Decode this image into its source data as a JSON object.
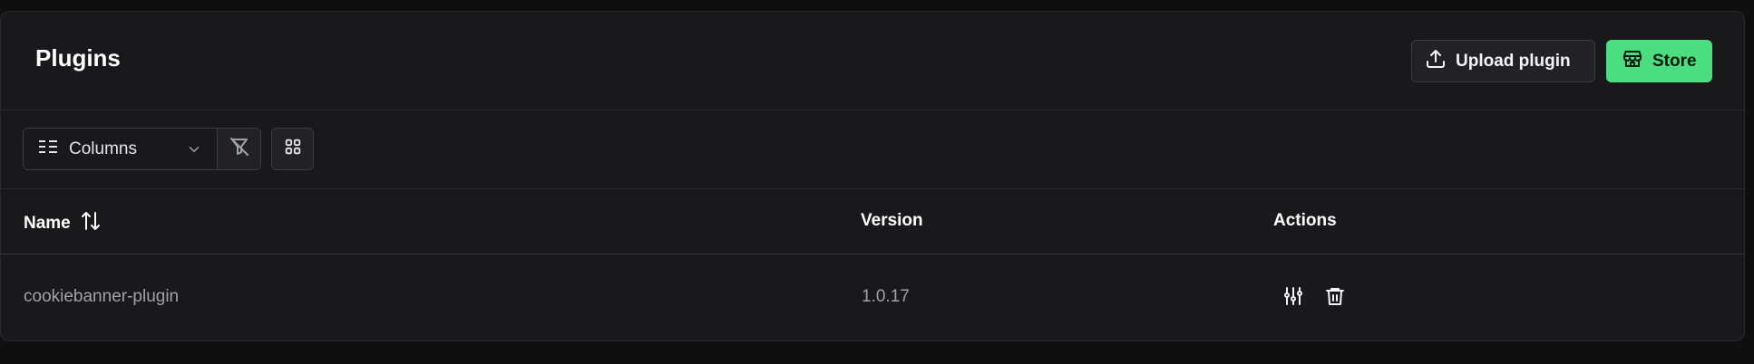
{
  "header": {
    "title": "Plugins",
    "upload_label": "Upload plugin",
    "store_label": "Store"
  },
  "toolbar": {
    "columns_label": "Columns"
  },
  "table": {
    "columns": [
      "Name",
      "Version",
      "Actions"
    ],
    "rows": [
      {
        "name": "cookiebanner-plugin",
        "version": "1.0.17"
      }
    ]
  },
  "colors": {
    "accent": "#4ade80",
    "background": "#19191b",
    "border": "#2b2b2e"
  },
  "icons": {
    "upload": "upload-icon",
    "store": "store-icon",
    "columns": "columns-list-icon",
    "chevron": "chevron-down-icon",
    "clear_filter": "filter-off-icon",
    "grid": "grid-icon",
    "sort": "sort-icon",
    "settings": "sliders-icon",
    "delete": "trash-icon"
  }
}
